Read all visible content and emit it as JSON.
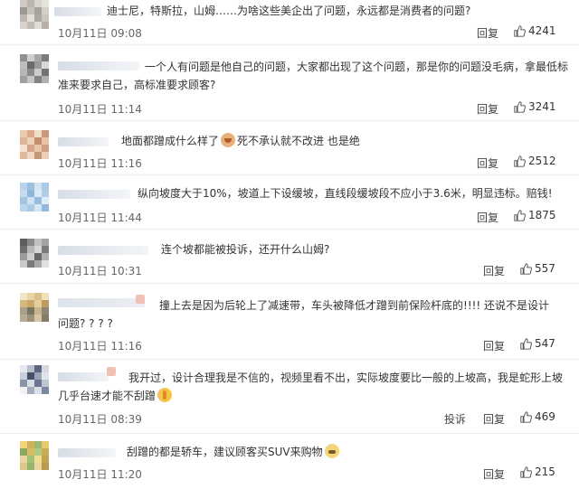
{
  "colors": {
    "text": "#333333",
    "meta": "#666666",
    "divider": "#eeeeee"
  },
  "comments": [
    {
      "text": "迪士尼，特斯拉，山姆……为啥这些美企出了问题，永远都是消费者的问题?",
      "time": "10月11日 09:08",
      "report": "",
      "reply": "回复",
      "likes": "4241",
      "emoji": ""
    },
    {
      "text1": "一个人有问题是他自己的问题，大家都出现了这个问题，那是你的问题没毛病，拿最低标",
      "text2": "准来要求自己，高标准要求顾客?",
      "time": "10月11日 11:14",
      "reply": "回复",
      "likes": "3241"
    },
    {
      "text_a": "地面都蹭成什么样了",
      "text_b": "死不承认就不改进 也是绝",
      "emoji": "cat-icon",
      "time": "10月11日 11:16",
      "reply": "回复",
      "likes": "2512"
    },
    {
      "text": "纵向坡度大于10%，坡道上下设缓坡，直线段缓坡段不应小于3.6米，明显违标。赔钱!",
      "time": "10月11日 11:44",
      "reply": "回复",
      "likes": "1875"
    },
    {
      "text": "连个坡都能被投诉，还开什么山姆?",
      "time": "10月11日 10:31",
      "reply": "回复",
      "likes": "557"
    },
    {
      "text1": "撞上去是因为后轮上了减速带，车头被降低才蹭到前保险杆底的!!!! 还说不是设计",
      "text2": "问题? ? ? ?",
      "time": "10月11日 11:16",
      "reply": "回复",
      "likes": "547"
    },
    {
      "text1": "我开过，设计合理我是不信的，视频里看不出，实际坡度要比一般的上坡高，我是蛇形上坡",
      "text2": "几乎台速才能不刮蹭",
      "emoji": "pray-icon",
      "time": "10月11日 08:39",
      "report": "投诉",
      "reply": "回复",
      "likes": "469"
    },
    {
      "text": "刮蹭的都是轿车，建议顾客买SUV来购物",
      "emoji": "doge-icon",
      "time": "10月11日 11:20",
      "reply": "回复",
      "likes": "215"
    }
  ]
}
